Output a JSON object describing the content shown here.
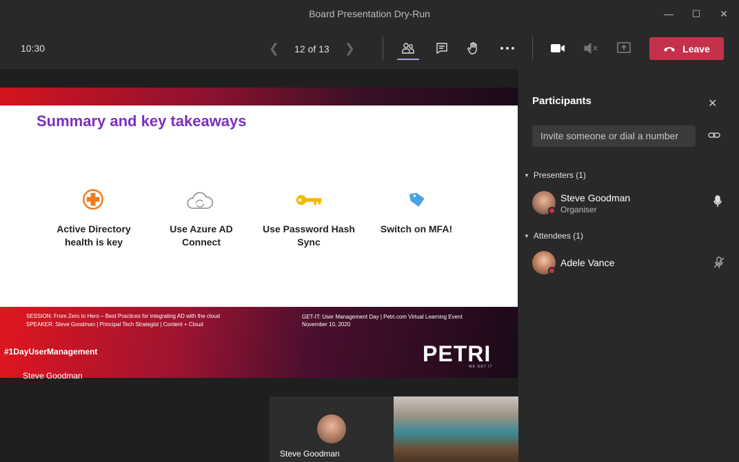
{
  "window": {
    "title": "Board Presentation Dry-Run"
  },
  "toolbar": {
    "time": "10:30",
    "slide_counter": "12 of 13",
    "leave_label": "Leave",
    "icons": [
      "participants-icon",
      "chat-icon",
      "raise-hand-icon",
      "more-options-icon",
      "camera-icon",
      "mic-muted-icon",
      "share-screen-icon"
    ]
  },
  "slide": {
    "title": "Summary and key takeaways",
    "takeaways": [
      {
        "label": "Active Directory health is key",
        "icon": "health-cross-icon"
      },
      {
        "label": "Use Azure AD Connect",
        "icon": "cloud-sync-icon"
      },
      {
        "label": "Use Password Hash Sync",
        "icon": "key-icon"
      },
      {
        "label": "Switch on MFA!",
        "icon": "tag-icon"
      }
    ],
    "session_line": "SESSION: From Zero to Hero – Best Practices for integrating AD with the cloud",
    "speaker_line": "SPEAKER: Steve Goodman | Principal Tech Strategist | Content + Cloud",
    "event_line": "GET-IT: User Management Day |  Petri.com Virtual Learning Event",
    "date_line": "November 10, 2020",
    "hashtag": "#1DayUserManagement",
    "logo": "PETRI",
    "logo_tagline": "WE GET IT",
    "presenter_name": "Steve Goodman"
  },
  "video_tiles": [
    {
      "name": "Steve Goodman"
    },
    {
      "name": ""
    }
  ],
  "participants": {
    "title": "Participants",
    "invite_placeholder": "Invite someone or dial a number",
    "presenters_header": "Presenters (1)",
    "attendees_header": "Attendees (1)",
    "presenters": [
      {
        "name": "Steve Goodman",
        "role": "Organiser",
        "mic": "mic-on"
      }
    ],
    "attendees": [
      {
        "name": "Adele Vance",
        "role": "",
        "mic": "mic-off"
      }
    ]
  },
  "colors": {
    "leave": "#c4314b",
    "slide_title": "#7b2fbe",
    "status_dot": "#c4314b"
  }
}
